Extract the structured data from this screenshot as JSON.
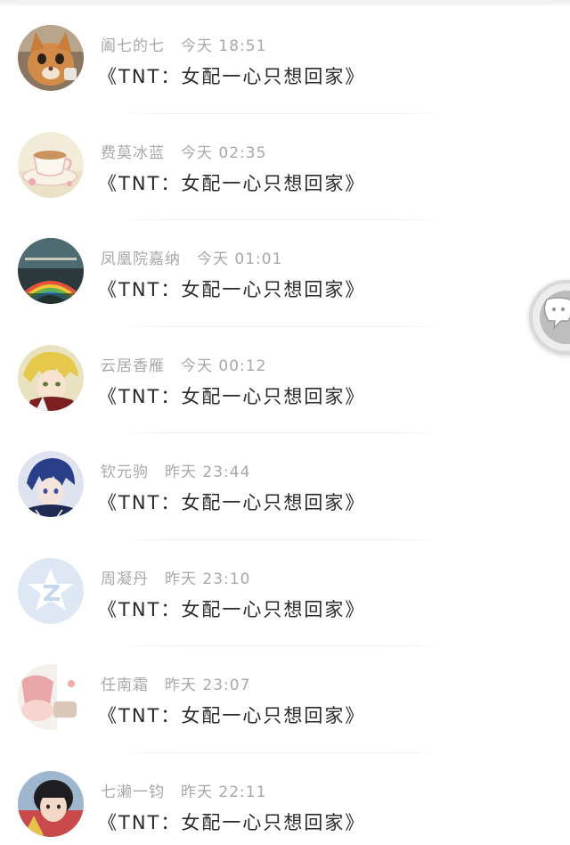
{
  "comments": [
    {
      "username": "阖七的七",
      "time": "今天 18:51",
      "message": "《TNT：女配一心只想回家》",
      "avatar": "cat-avatar"
    },
    {
      "username": "费莫冰蓝",
      "time": "今天 02:35",
      "message": "《TNT：女配一心只想回家》",
      "avatar": "teacup-avatar"
    },
    {
      "username": "凤凰院嘉纳",
      "time": "今天 01:01",
      "message": "《TNT：女配一心只想回家》",
      "avatar": "rainbow-avatar"
    },
    {
      "username": "云居香雁",
      "time": "今天 00:12",
      "message": "《TNT：女配一心只想回家》",
      "avatar": "anime-boy-blond-avatar"
    },
    {
      "username": "钦元驹",
      "time": "昨天 23:44",
      "message": "《TNT：女配一心只想回家》",
      "avatar": "anime-boy-blue-avatar"
    },
    {
      "username": "周凝丹",
      "time": "昨天 23:10",
      "message": "《TNT：女配一心只想回家》",
      "avatar": "default-avatar"
    },
    {
      "username": "任南霜",
      "time": "昨天 23:07",
      "message": "《TNT：女配一心只想回家》",
      "avatar": "pink-photo-avatar"
    },
    {
      "username": "七濑一钧",
      "time": "昨天 22:11",
      "message": "《TNT：女配一心只想回家》",
      "avatar": "child-photo-avatar"
    }
  ],
  "floating_button": {
    "icon": "chat-bubble-icon"
  },
  "colors": {
    "username": "#a8a8a8",
    "message": "#2a2a2a",
    "background": "#ffffff"
  }
}
